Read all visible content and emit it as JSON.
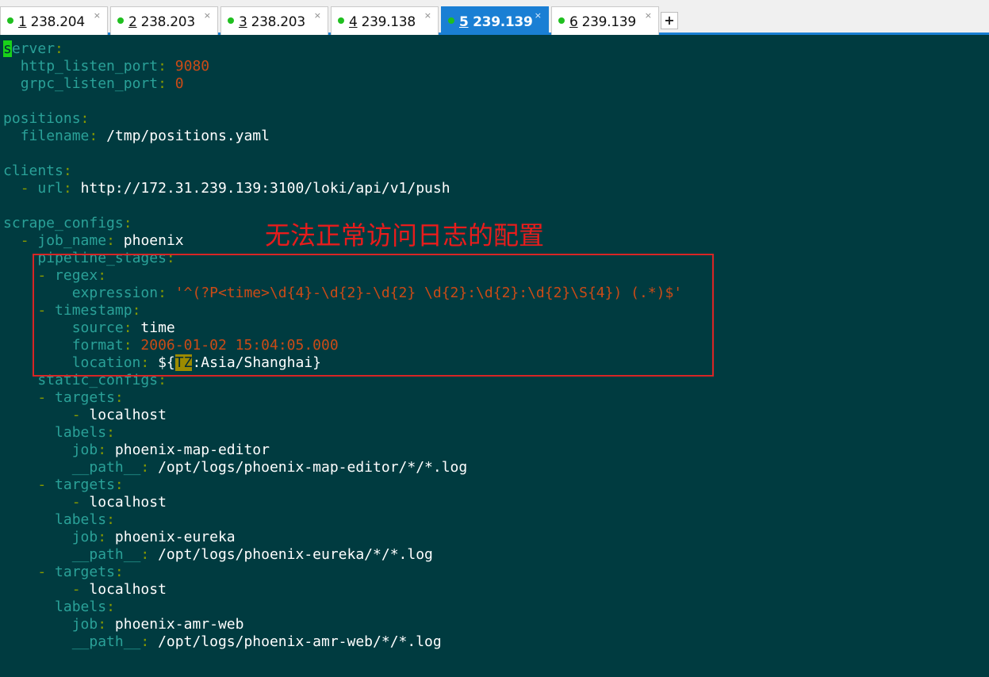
{
  "tabs": [
    {
      "num": "1",
      "host": " 238.204",
      "close": "×",
      "dot_color": "#1fbf1f"
    },
    {
      "num": "2",
      "host": " 238.203",
      "close": "×",
      "dot_color": "#1fbf1f"
    },
    {
      "num": "3",
      "host": " 238.203",
      "close": "×",
      "dot_color": "#1fbf1f"
    },
    {
      "num": "4",
      "host": " 239.138",
      "close": "×",
      "dot_color": "#1fbf1f"
    },
    {
      "num": "5",
      "host": " 239.139",
      "close": "×",
      "dot_color": "#1fbf1f"
    },
    {
      "num": "6",
      "host": " 239.139",
      "close": "×",
      "dot_color": "#1fbf1f"
    }
  ],
  "active_tab": "5",
  "new_tab_label": "+",
  "annotation": "无法正常访问日志的配置",
  "code": {
    "l1_c": "s",
    "l1_k": "erver",
    "l1_p": ":",
    "l2_k": "http_listen_port",
    "l2_p": ":",
    "l2_v": "9080",
    "l3_k": "grpc_listen_port",
    "l3_p": ":",
    "l3_v": "0",
    "l5_k": "positions",
    "l5_p": ":",
    "l6_k": "filename",
    "l6_p": ":",
    "l6_v": "/tmp/positions.yaml",
    "l8_k": "clients",
    "l8_p": ":",
    "l9_d": "-",
    "l9_k": "url",
    "l9_p": ":",
    "l9_v": "http://172.31.239.139:3100/loki/api/v1/push",
    "l11_k": "scrape_configs",
    "l11_p": ":",
    "l12_d": "-",
    "l12_k": "job_name",
    "l12_p": ":",
    "l12_v": "phoenix",
    "l13_k": "pipeline_stages",
    "l13_p": ":",
    "l14_d": "-",
    "l14_k": "regex",
    "l14_p": ":",
    "l15_k": "expression",
    "l15_p": ":",
    "l15_v": "'^(?P<time>\\d{4}-\\d{2}-\\d{2} \\d{2}:\\d{2}:\\d{2}\\S{4}) (.*)$'",
    "l16_d": "-",
    "l16_k": "timestamp",
    "l16_p": ":",
    "l17_k": "source",
    "l17_p": ":",
    "l17_v": "time",
    "l18_k": "format",
    "l18_p": ":",
    "l18_v": "2006-01-02 15:04:05.000",
    "l19_k": "location",
    "l19_p": ":",
    "l19_v1": "${",
    "l19_hl": "TZ",
    "l19_v2": ":Asia/Shanghai}",
    "l20_k": "static_configs",
    "l20_p": ":",
    "l21_d": "-",
    "l21_k": "targets",
    "l21_p": ":",
    "l22_d": "-",
    "l22_v": "localhost",
    "l23_k": "labels",
    "l23_p": ":",
    "l24_k": "job",
    "l24_p": ":",
    "l24_v": "phoenix-map-editor",
    "l25_k": "__path__",
    "l25_p": ":",
    "l25_v": "/opt/logs/phoenix-map-editor/*/*.log",
    "l26_d": "-",
    "l26_k": "targets",
    "l26_p": ":",
    "l27_d": "-",
    "l27_v": "localhost",
    "l28_k": "labels",
    "l28_p": ":",
    "l29_k": "job",
    "l29_p": ":",
    "l29_v": "phoenix-eureka",
    "l30_k": "__path__",
    "l30_p": ":",
    "l30_v": "/opt/logs/phoenix-eureka/*/*.log",
    "l31_d": "-",
    "l31_k": "targets",
    "l31_p": ":",
    "l32_d": "-",
    "l32_v": "localhost",
    "l33_k": "labels",
    "l33_p": ":",
    "l34_k": "job",
    "l34_p": ":",
    "l34_v": "phoenix-amr-web",
    "l35_k": "__path__",
    "l35_p": ":",
    "l35_v": "/opt/logs/phoenix-amr-web/*/*.log"
  }
}
